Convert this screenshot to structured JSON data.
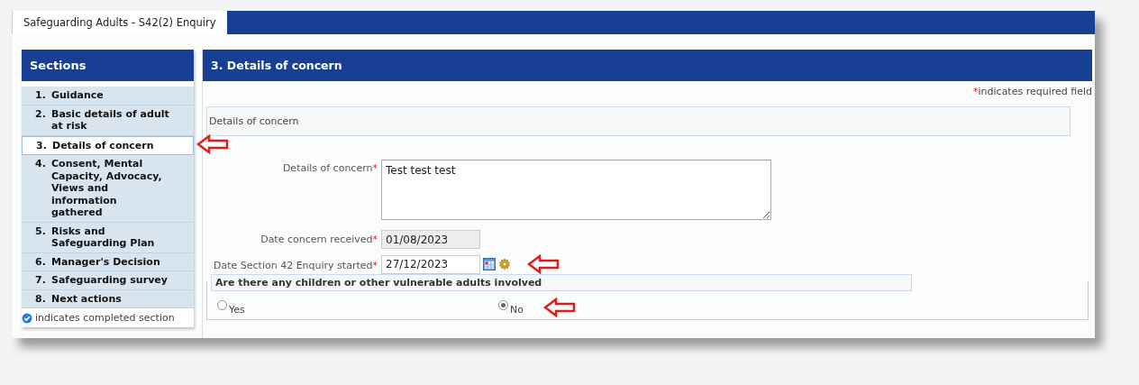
{
  "tabs": [
    {
      "label": "Safeguarding Adults - S42(2) Enquiry",
      "selected": true
    }
  ],
  "sidebar": {
    "title": "Sections",
    "items": [
      {
        "number": "1.",
        "label": "Guidance",
        "selected": false,
        "pointed_at": false
      },
      {
        "number": "2.",
        "label": "Basic details of adult at risk",
        "selected": false,
        "pointed_at": false
      },
      {
        "number": "3.",
        "label": "Details of concern",
        "selected": true,
        "pointed_at": true
      },
      {
        "number": "4.",
        "label": "Consent, Mental Capacity, Advocacy, Views and information gathered",
        "selected": false,
        "pointed_at": false
      },
      {
        "number": "5.",
        "label": "Risks and Safeguarding Plan",
        "selected": false,
        "pointed_at": false
      },
      {
        "number": "6.",
        "label": "Manager's Decision",
        "selected": false,
        "pointed_at": false
      },
      {
        "number": "7.",
        "label": "Safeguarding survey",
        "selected": false,
        "pointed_at": false
      },
      {
        "number": "8.",
        "label": "Next actions",
        "selected": false,
        "pointed_at": false
      }
    ],
    "legend": "indicates completed section"
  },
  "main": {
    "title": "3. Details of concern",
    "required_note": {
      "mark": "*",
      "text": "indicates required field"
    },
    "section_title": "Details of concern",
    "fields": [
      {
        "kind": "textarea",
        "label": "Details of concern",
        "required_mark": "*",
        "value": "Test test test",
        "readonly": false,
        "pointed_at": false
      },
      {
        "kind": "date",
        "label": "Date concern received",
        "required_mark": "*",
        "value": "01/08/2023",
        "readonly": true,
        "pointed_at": false
      },
      {
        "kind": "date_picker",
        "label": "Date Section 42 Enquiry started",
        "required_mark": "*",
        "value": "27/12/2023",
        "readonly": false,
        "pointed_at": true
      }
    ],
    "question": {
      "legend": "Are there any children or other vulnerable adults involved",
      "options": [
        {
          "label": "Yes",
          "selected": false,
          "pointed_at": false
        },
        {
          "label": "No",
          "selected": true,
          "pointed_at": true
        }
      ]
    }
  }
}
